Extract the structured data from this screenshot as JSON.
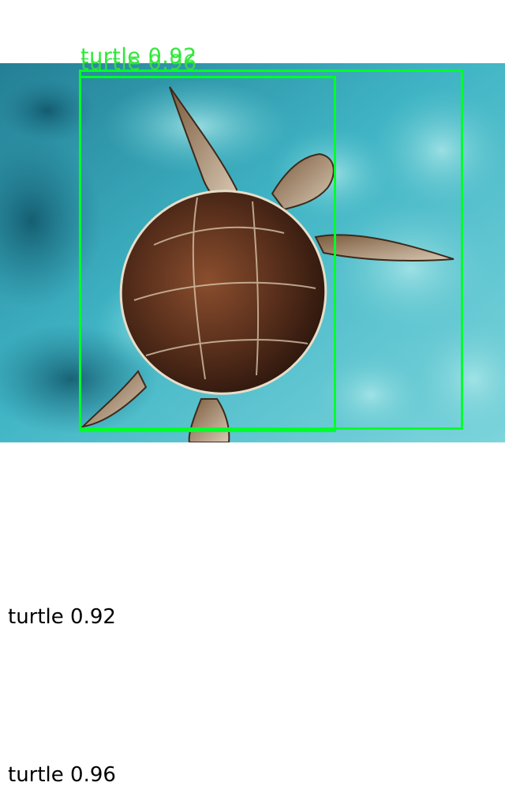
{
  "detections": [
    {
      "label": "turtle",
      "score": "0.92",
      "text": "turtle 0.92",
      "color": "#00ff2a"
    },
    {
      "label": "turtle",
      "score": "0.96",
      "text": "turtle 0.96",
      "color": "#00ff2a"
    }
  ],
  "captions": [
    "turtle 0.92",
    "turtle 0.96"
  ],
  "colors": {
    "box": "#00ff2a",
    "label_text": "#2fe83a",
    "caption_text": "#000000",
    "background": "#ffffff",
    "water": "#3fb4c4",
    "shell": "#5a301c"
  }
}
